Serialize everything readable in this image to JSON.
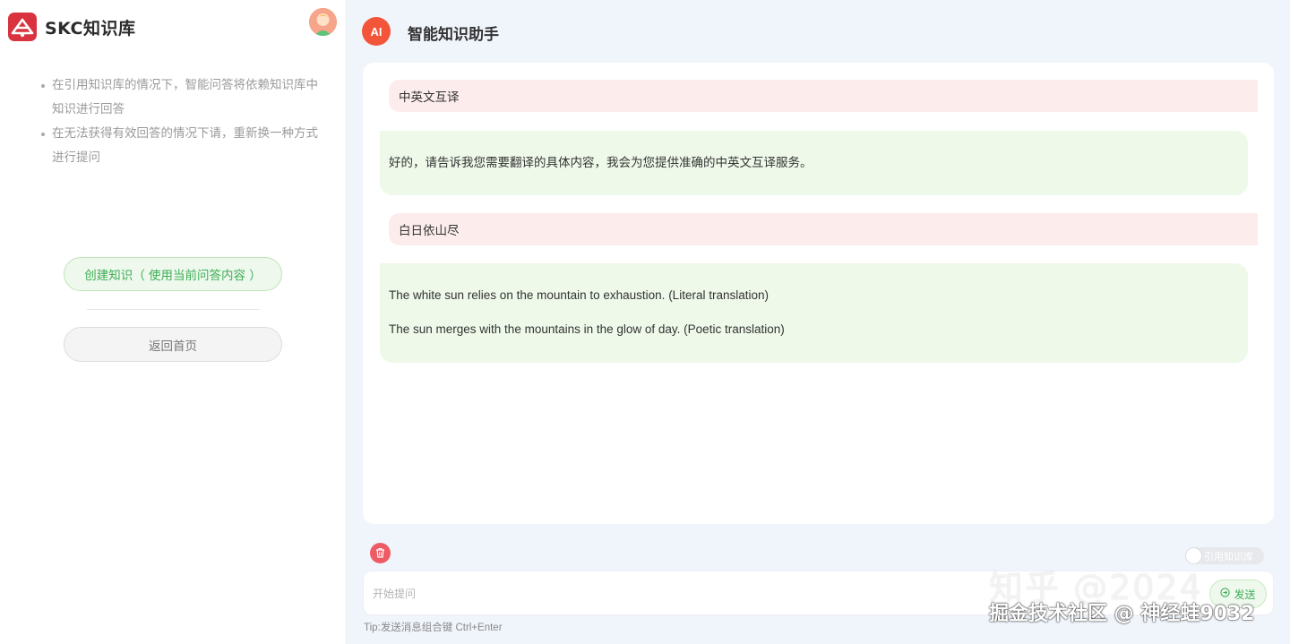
{
  "brand": {
    "name": "SKC知识库",
    "logo_icon": "skc-logo-icon",
    "accent": "#d9333f"
  },
  "user": {
    "avatar_icon": "user-avatar-icon"
  },
  "sidebar": {
    "tips": [
      "在引用知识库的情况下，智能问答将依赖知识库中知识进行回答",
      "在无法获得有效回答的情况下请，重新换一种方式进行提问"
    ],
    "create_label": "创建知识（ 使用当前问答内容 ）",
    "home_label": "返回首页"
  },
  "header": {
    "badge": "AI",
    "title": "智能知识助手"
  },
  "messages": [
    {
      "role": "user",
      "text": "中英文互译"
    },
    {
      "role": "assistant",
      "lines": [
        "好的，请告诉我您需要翻译的具体内容，我会为您提供准确的中英文互译服务。"
      ]
    },
    {
      "role": "user",
      "text": "白日依山尽"
    },
    {
      "role": "assistant",
      "lines": [
        "The white sun relies on the mountain to exhaustion. (Literal translation)",
        "The sun merges with the mountains in the glow of day. (Poetic translation)"
      ]
    }
  ],
  "controls": {
    "delete_icon": "trash-icon",
    "toggle_label": "引用知识库",
    "toggle_on": false
  },
  "composer": {
    "placeholder": "开始提问",
    "value": "",
    "send_label": "发送",
    "send_icon": "send-icon",
    "tip": "Tip:发送消息组合键  Ctrl+Enter"
  },
  "watermark": {
    "line1": "知乎 @2024",
    "line2": "掘金技术社区 @ 神经蛙9032"
  },
  "colors": {
    "green": "#3eae57",
    "user_bubble": "#fcecec",
    "ai_bubble": "#eef9e9",
    "ai_badge": "#f2553a"
  }
}
